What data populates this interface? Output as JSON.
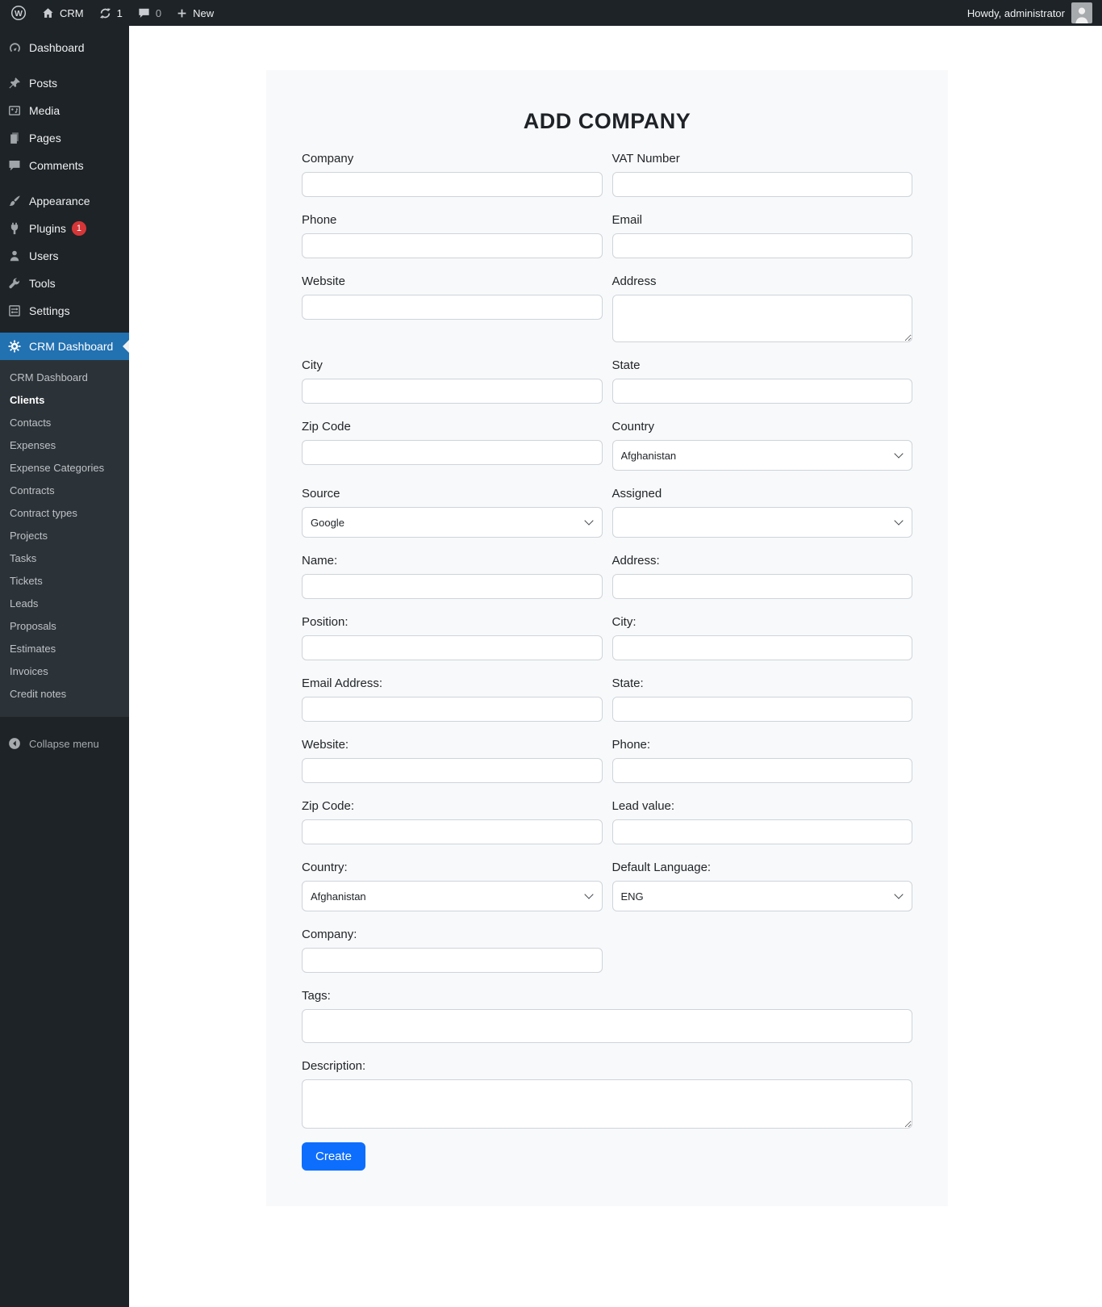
{
  "admin_bar": {
    "site_name": "CRM",
    "update_count": "1",
    "comment_count": "0",
    "new_label": "New",
    "howdy": "Howdy, administrator"
  },
  "sidebar": {
    "menu": [
      {
        "label": "Dashboard"
      },
      {
        "label": "Posts"
      },
      {
        "label": "Media"
      },
      {
        "label": "Pages"
      },
      {
        "label": "Comments"
      },
      {
        "label": "Appearance"
      },
      {
        "label": "Plugins",
        "badge": "1"
      },
      {
        "label": "Users"
      },
      {
        "label": "Tools"
      },
      {
        "label": "Settings"
      },
      {
        "label": "CRM Dashboard",
        "active": true
      }
    ],
    "submenu": {
      "items": [
        {
          "label": "CRM Dashboard"
        },
        {
          "label": "Clients",
          "current": true
        },
        {
          "label": "Contacts"
        },
        {
          "label": "Expenses"
        },
        {
          "label": "Expense Categories"
        },
        {
          "label": "Contracts"
        },
        {
          "label": "Contract types"
        },
        {
          "label": "Projects"
        },
        {
          "label": "Tasks"
        },
        {
          "label": "Tickets"
        },
        {
          "label": "Leads"
        },
        {
          "label": "Proposals"
        },
        {
          "label": "Estimates"
        },
        {
          "label": "Invoices"
        },
        {
          "label": "Credit notes"
        }
      ]
    },
    "collapse_label": "Collapse menu"
  },
  "form": {
    "title": "ADD COMPANY",
    "company": {
      "label": "Company",
      "value": ""
    },
    "vat": {
      "label": "VAT Number",
      "value": ""
    },
    "phone": {
      "label": "Phone",
      "value": ""
    },
    "email": {
      "label": "Email",
      "value": ""
    },
    "website": {
      "label": "Website",
      "value": ""
    },
    "address": {
      "label": "Address",
      "value": ""
    },
    "city": {
      "label": "City",
      "value": ""
    },
    "state": {
      "label": "State",
      "value": ""
    },
    "zip": {
      "label": "Zip Code",
      "value": ""
    },
    "country": {
      "label": "Country",
      "value": "Afghanistan"
    },
    "source": {
      "label": "Source",
      "value": "Google"
    },
    "assigned": {
      "label": "Assigned",
      "value": ""
    },
    "contact_name": {
      "label": "Name:",
      "value": ""
    },
    "contact_address": {
      "label": "Address:",
      "value": ""
    },
    "contact_position": {
      "label": "Position:",
      "value": ""
    },
    "contact_city": {
      "label": "City:",
      "value": ""
    },
    "contact_email": {
      "label": "Email Address:",
      "value": ""
    },
    "contact_state": {
      "label": "State:",
      "value": ""
    },
    "contact_website": {
      "label": "Website:",
      "value": ""
    },
    "contact_phone": {
      "label": "Phone:",
      "value": ""
    },
    "contact_zip": {
      "label": "Zip Code:",
      "value": ""
    },
    "lead_value": {
      "label": "Lead value:",
      "value": ""
    },
    "contact_country": {
      "label": "Country:",
      "value": "Afghanistan"
    },
    "default_language": {
      "label": "Default Language:",
      "value": "ENG"
    },
    "contact_company": {
      "label": "Company:",
      "value": ""
    },
    "tags": {
      "label": "Tags:",
      "value": ""
    },
    "description": {
      "label": "Description:",
      "value": ""
    },
    "create_label": "Create"
  },
  "colors": {
    "admin_bar_bg": "#1d2327",
    "sidebar_bg": "#1d2327",
    "submenu_bg": "#2c3338",
    "active_menu_bg": "#2271b1",
    "badge_red": "#d63638",
    "card_bg": "#f8f9fa",
    "input_border": "#ced4da",
    "create_button": "#0d6efd"
  }
}
